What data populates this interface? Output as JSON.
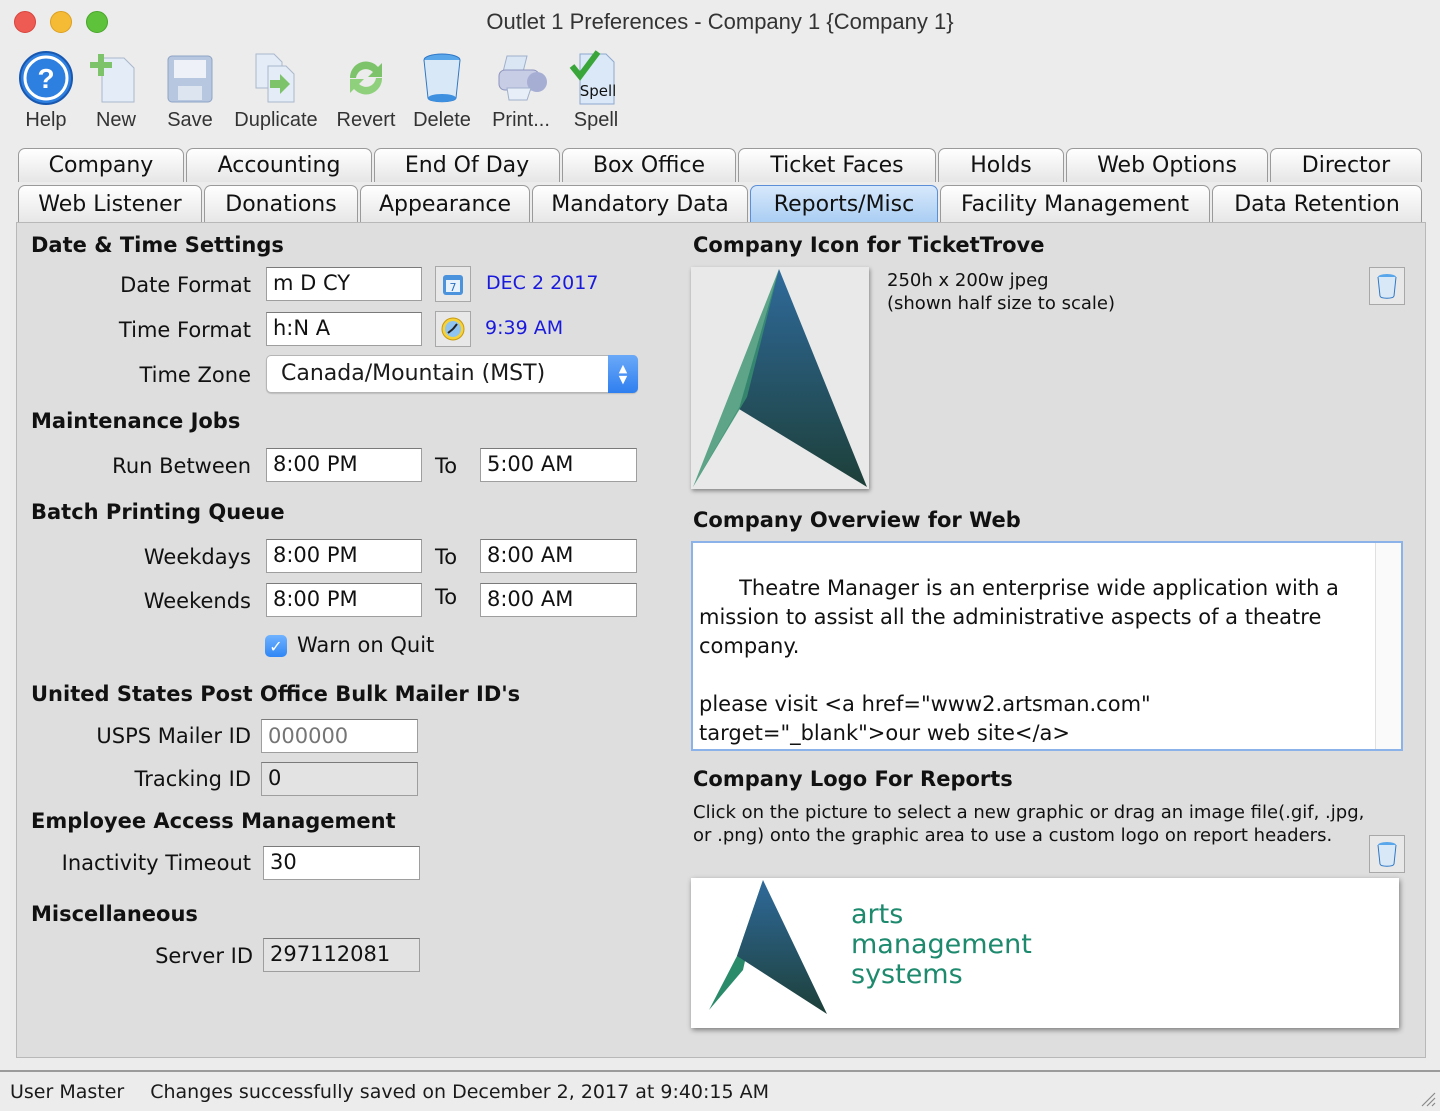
{
  "window": {
    "title": "Outlet 1 Preferences - Company 1 {Company 1}"
  },
  "toolbar": [
    {
      "label": "Help",
      "icon": "help-icon"
    },
    {
      "label": "New",
      "icon": "new-document-icon"
    },
    {
      "label": "Save",
      "icon": "save-disk-icon"
    },
    {
      "label": "Duplicate",
      "icon": "duplicate-icon"
    },
    {
      "label": "Revert",
      "icon": "revert-icon"
    },
    {
      "label": "Delete",
      "icon": "trash-icon"
    },
    {
      "label": "Print...",
      "icon": "printer-icon"
    },
    {
      "label": "Spell",
      "icon": "spell-check-icon",
      "badge": "Spell"
    }
  ],
  "tabs": {
    "row1": [
      "Company",
      "Accounting",
      "End Of Day",
      "Box Office",
      "Ticket Faces",
      "Holds",
      "Web Options",
      "Director"
    ],
    "row2": [
      "Web Listener",
      "Donations",
      "Appearance",
      "Mandatory Data",
      "Reports/Misc",
      "Facility Management",
      "Data Retention"
    ],
    "active": "Reports/Misc"
  },
  "datetime": {
    "heading": "Date & Time Settings",
    "date_format_label": "Date Format",
    "date_format_value": "m D CY",
    "date_preview": "DEC 2 2017",
    "time_format_label": "Time Format",
    "time_format_value": "h:N A",
    "time_preview": "9:39 AM",
    "time_zone_label": "Time Zone",
    "time_zone_value": "Canada/Mountain (MST)"
  },
  "maintenance": {
    "heading": "Maintenance Jobs",
    "run_between_label": "Run Between",
    "from": "8:00 PM",
    "to_label": "To",
    "to": "5:00 AM"
  },
  "batch": {
    "heading": "Batch Printing Queue",
    "weekdays_label": "Weekdays",
    "weekdays_from": "8:00 PM",
    "weekdays_to": "8:00 AM",
    "weekends_label": "Weekends",
    "weekends_from": "8:00 PM",
    "weekends_to": "8:00 AM",
    "to_label": "To",
    "warn_on_quit_label": "Warn on Quit",
    "warn_on_quit_checked": true
  },
  "usps": {
    "heading": "United States Post Office Bulk Mailer ID's",
    "mailer_id_label": "USPS Mailer ID",
    "mailer_id_placeholder": "000000",
    "tracking_id_label": "Tracking ID",
    "tracking_id_value": "0"
  },
  "employee": {
    "heading": "Employee Access Management",
    "inactivity_label": "Inactivity Timeout",
    "inactivity_value": "30"
  },
  "misc": {
    "heading": "Miscellaneous",
    "server_id_label": "Server ID",
    "server_id_value": "297112081"
  },
  "ticket_icon": {
    "heading": "Company Icon for TicketTrove",
    "size_note": "250h x 200w jpeg",
    "scale_note": "(shown half size to scale)"
  },
  "overview": {
    "heading": "Company Overview for Web",
    "text": "Theatre Manager is an enterprise wide application with a\nmission to assist all the administrative aspects of a theatre\ncompany.\n\nplease visit <a href=\"www2.artsman.com\"\ntarget=\"_blank\">our web site</a>"
  },
  "report_logo": {
    "heading": "Company Logo For Reports",
    "instructions": "Click on the picture to select a new graphic or drag an image file(.gif, .jpg, or .png) onto the graphic area to use a custom logo on report headers.",
    "logo_line1": "arts",
    "logo_line2": "management",
    "logo_line3": "systems"
  },
  "status": {
    "user": "User Master",
    "message": "Changes successfully saved on December 2, 2017 at 9:40:15 AM"
  },
  "colors": {
    "accent": "#3b82f0",
    "preview_text": "#1a1adc",
    "logo_green": "#1d8a6e",
    "logo_blue": "#2e6a96"
  }
}
